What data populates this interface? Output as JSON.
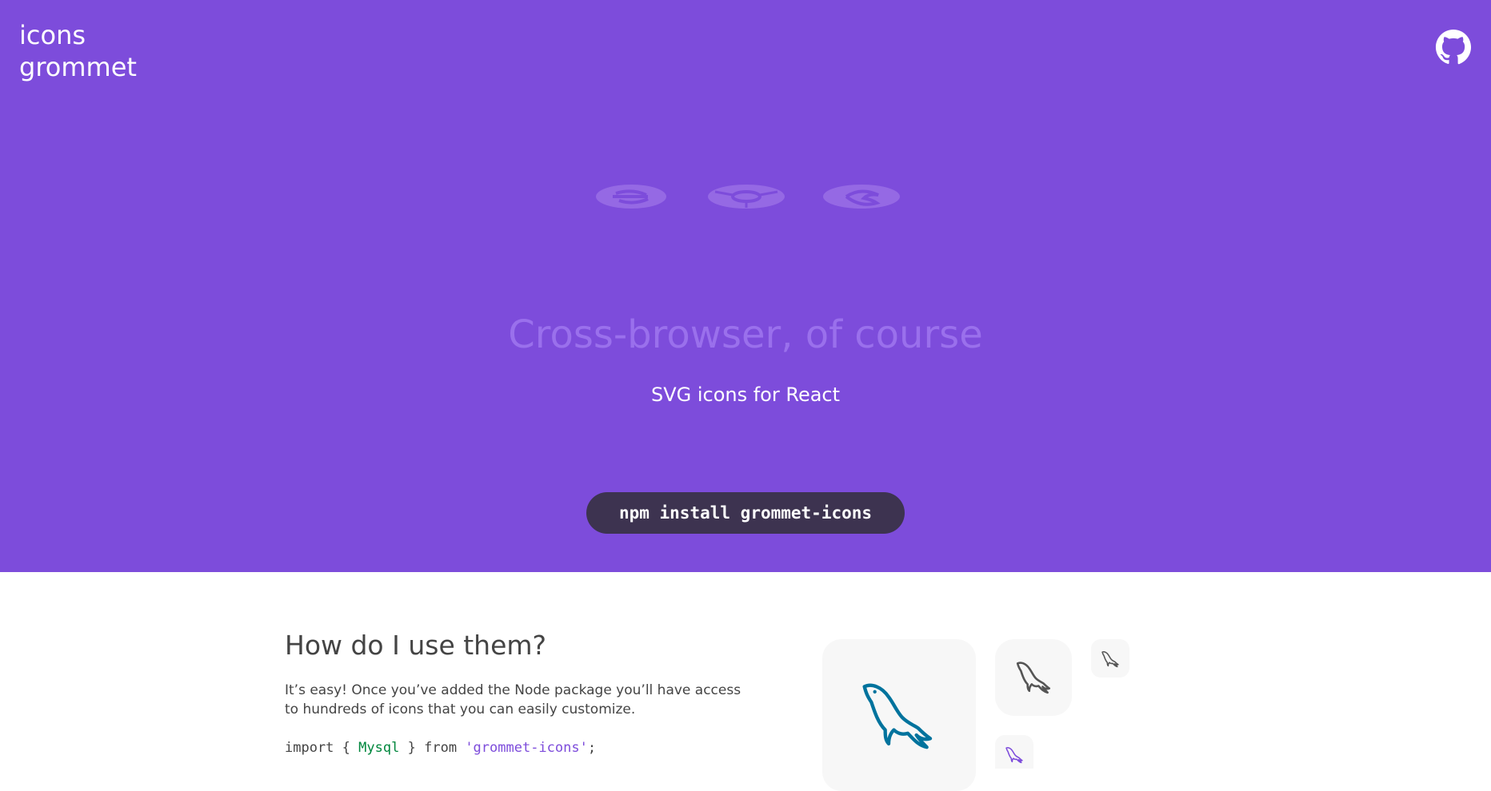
{
  "brand": {
    "line1": "icons",
    "line2": "grommet"
  },
  "header": {
    "github_icon": "github-icon"
  },
  "hero": {
    "background_color": "#7d4cdb",
    "browser_icons": [
      "edge-icon",
      "chrome-icon",
      "firefox-icon"
    ],
    "heading": "Cross-browser, of course",
    "subheading": "SVG icons for React",
    "install_command": "npm install grommet-icons",
    "install_button_color": "#3d3350"
  },
  "usage": {
    "heading": "How do I use them?",
    "description": "It’s easy! Once you’ve added the Node package you’ll have access to hundreds of icons that you can easily customize.",
    "code": {
      "keyword_import": "import",
      "brace_open": "{",
      "identifier": "Mysql",
      "brace_close": "}",
      "keyword_from": "from",
      "module": "'grommet-icons'",
      "terminator": ";"
    }
  },
  "preview": {
    "icon": "mysql-icon",
    "tiles": [
      {
        "size": "large",
        "color": "#00739d"
      },
      {
        "size": "medium",
        "color": "#555555"
      },
      {
        "size": "small",
        "color": "#555555"
      },
      {
        "size": "small",
        "color": "#7d4cdb"
      }
    ]
  }
}
